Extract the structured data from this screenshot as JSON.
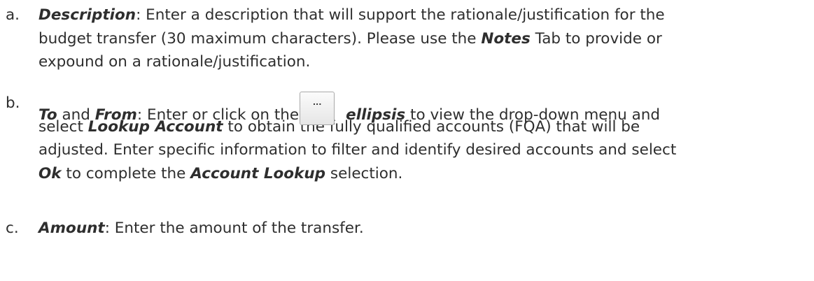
{
  "items": [
    {
      "marker": "a.",
      "lines": [
        [
          {
            "text": "Description",
            "style": "bi"
          },
          {
            "text": ": Enter a description that will support the rationale/justification for the",
            "style": "normal"
          }
        ],
        [
          {
            "text": "budget transfer (30 maximum characters). Please use the ",
            "style": "normal"
          },
          {
            "text": "Notes",
            "style": "bi"
          },
          {
            "text": " Tab to provide or",
            "style": "normal"
          }
        ],
        [
          {
            "text": "expound on a rationale/justification.",
            "style": "normal"
          }
        ]
      ]
    },
    {
      "marker": "b.",
      "line1": {
        "to": "To",
        "and": " and ",
        "from": "From",
        "before_button": ": Enter or click on the",
        "button_label": "...",
        "ellipsis": "ellipsis",
        "after_button": " to view the drop-down menu and"
      },
      "lines": [
        [
          {
            "text": "select ",
            "style": "normal"
          },
          {
            "text": "Lookup Account",
            "style": "bi"
          },
          {
            "text": " to obtain the fully qualified accounts (FQA) that will be",
            "style": "normal"
          }
        ],
        [
          {
            "text": "adjusted. Enter specific information to filter and identify desired accounts and select",
            "style": "normal"
          }
        ],
        [
          {
            "text": "Ok",
            "style": "bi"
          },
          {
            "text": " to complete the ",
            "style": "normal"
          },
          {
            "text": "Account Lookup",
            "style": "bi"
          },
          {
            "text": " selection.",
            "style": "normal"
          }
        ]
      ]
    },
    {
      "marker": "c.",
      "lines": [
        [
          {
            "text": "Amount",
            "style": "bi"
          },
          {
            "text": ": Enter the amount of the transfer.",
            "style": "normal"
          }
        ]
      ]
    }
  ]
}
